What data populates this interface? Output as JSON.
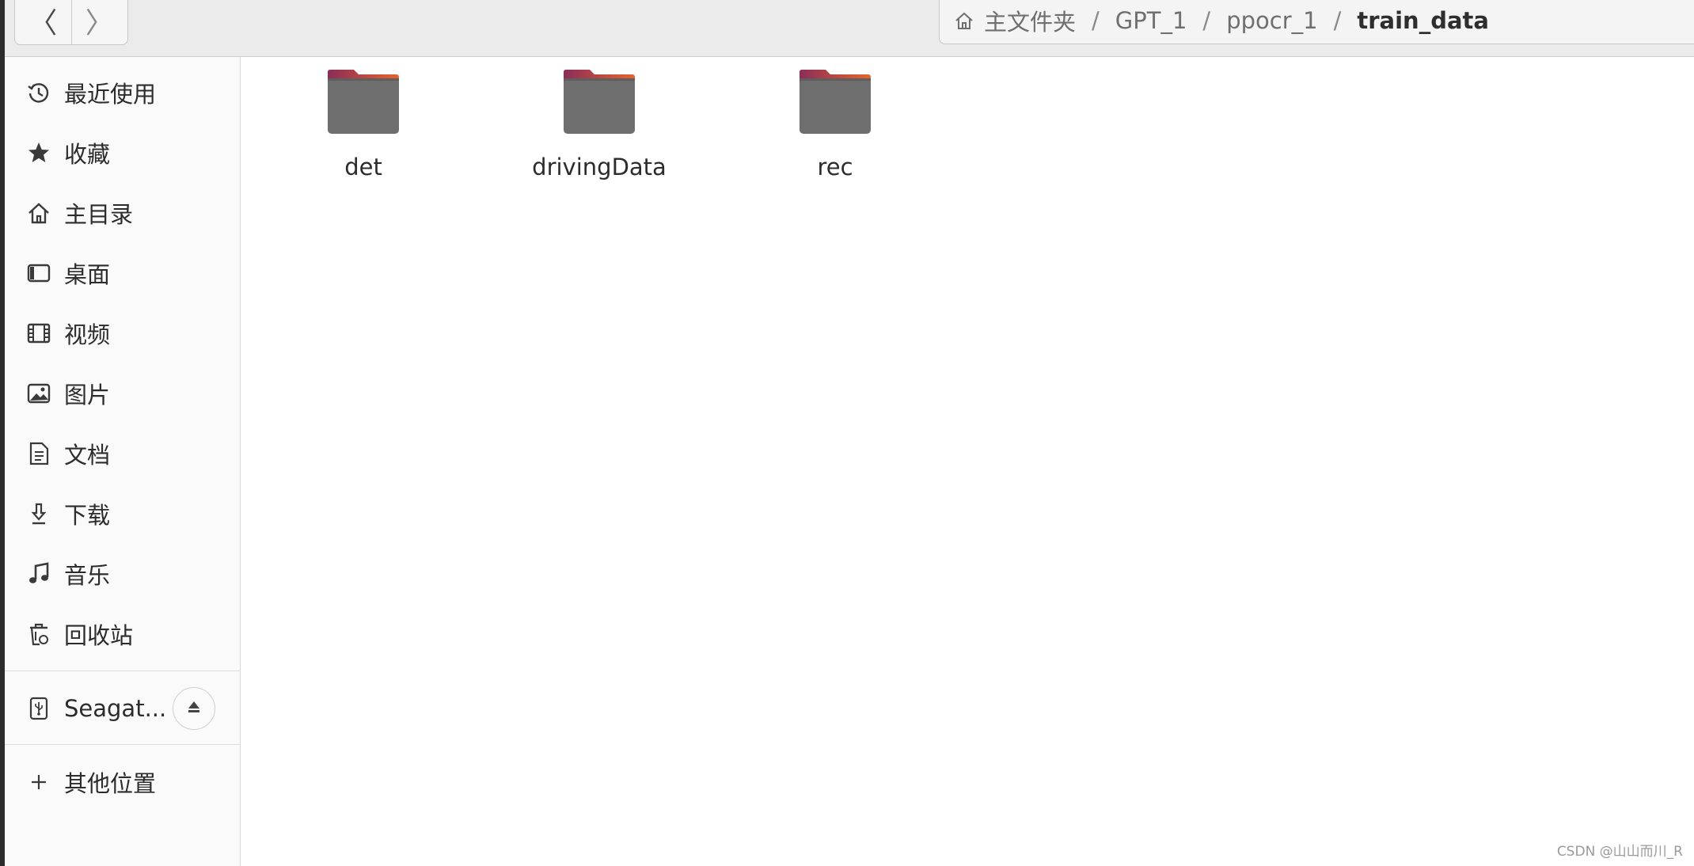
{
  "header": {
    "back_label": "〈",
    "forward_label": "〉",
    "breadcrumbs": [
      "主文件夹",
      "GPT_1",
      "ppocr_1",
      "train_data"
    ],
    "separator": "/"
  },
  "sidebar": {
    "items": [
      {
        "label": "最近使用",
        "icon": "clock-icon"
      },
      {
        "label": "收藏",
        "icon": "star-icon"
      },
      {
        "label": "主目录",
        "icon": "home-icon"
      },
      {
        "label": "桌面",
        "icon": "desktop-icon"
      },
      {
        "label": "视频",
        "icon": "film-icon"
      },
      {
        "label": "图片",
        "icon": "image-icon"
      },
      {
        "label": "文档",
        "icon": "document-icon"
      },
      {
        "label": "下载",
        "icon": "download-icon"
      },
      {
        "label": "音乐",
        "icon": "music-icon"
      },
      {
        "label": "回收站",
        "icon": "trash-icon"
      }
    ],
    "device": {
      "label": "Seagat...",
      "icon": "usb-drive-icon",
      "eject_icon": "eject-icon"
    },
    "other": {
      "label": "其他位置",
      "icon": "plus-icon"
    }
  },
  "content": {
    "folders": [
      {
        "name": "det"
      },
      {
        "name": "drivingData"
      },
      {
        "name": "rec"
      }
    ]
  },
  "watermark": "CSDN @山山而川_R",
  "colors": {
    "folder_body": "#6e6e6e",
    "folder_tab_start": "#8a2d5a",
    "folder_tab_end": "#e8632b",
    "headerbar": "#ebebeb",
    "sidebar": "#fafafa"
  }
}
